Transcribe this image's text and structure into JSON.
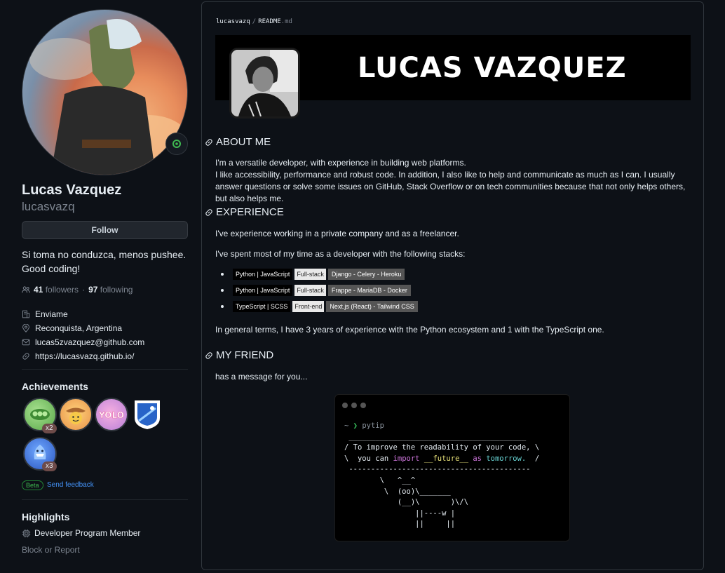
{
  "profile": {
    "name": "Lucas Vazquez",
    "login": "lucasvazq",
    "follow_label": "Follow",
    "bio_line1": "Si toma no conduzca, menos pushee.",
    "bio_line2": "Good coding!",
    "followers_count": "41",
    "followers_label": "followers",
    "separator": "·",
    "following_count": "97",
    "following_label": "following",
    "details": {
      "company": "Enviame",
      "location": "Reconquista, Argentina",
      "email": "lucas5zvazquez@github.com",
      "website": "https://lucasvazq.github.io/"
    }
  },
  "achievements": {
    "title": "Achievements",
    "badges": [
      {
        "name": "pair-extraordinaire",
        "count": "x2",
        "color": "#7bc96f"
      },
      {
        "name": "starstruck-cowboy",
        "count": "",
        "color": "#f4b266"
      },
      {
        "name": "yolo",
        "count": "",
        "color": "#d98ad9"
      },
      {
        "name": "arctic-code-vault",
        "count": "",
        "color": "#3d7fd8"
      },
      {
        "name": "pull-shark",
        "count": "x3",
        "color": "#3a6fd4"
      }
    ],
    "beta_label": "Beta",
    "feedback_label": "Send feedback"
  },
  "highlights": {
    "title": "Highlights",
    "item": "Developer Program Member",
    "block_report": "Block or Report"
  },
  "readme": {
    "breadcrumb_user": "lucasvazq",
    "breadcrumb_sep": "/",
    "breadcrumb_file": "README",
    "breadcrumb_ext": ".md",
    "banner_title": "LUCAS VAZQUEZ",
    "about_heading": "ABOUT ME",
    "about_line1": "I'm a versatile developer, with experience in building web platforms.",
    "about_line2": "I like accessibility, performance and robust code. In addition, I also like to help and communicate as much as I can. I usually answer questions or solve some issues on GitHub, Stack Overflow or on tech communities because that not only helps others, but also helps me.",
    "experience_heading": "EXPERIENCE",
    "exp_p1": "I've experience working in a private company and as a freelancer.",
    "exp_p2": "I've spent most of my time as a developer with the following stacks:",
    "stacks": [
      {
        "lang": "Python | JavaScript",
        "role": "Full-stack",
        "tools": "Django - Celery - Heroku"
      },
      {
        "lang": "Python | JavaScript",
        "role": "Full-stack",
        "tools": "Frappe - MariaDB - Docker"
      },
      {
        "lang": "TypeScript | SCSS",
        "role": "Front-end",
        "tools": "Next.js (React) - Tailwind CSS"
      }
    ],
    "exp_p3": "In general terms, I have 3 years of experience with the Python ecosystem and 1 with the TypeScript one.",
    "friend_heading": "MY FRIEND",
    "friend_p": "has a message for you...",
    "terminal": {
      "prompt_tilde": "~",
      "prompt_arrow": "❯",
      "command": "pytip",
      "top_rule": " ________________________________________",
      "line1": "/ To improve the readability of your code, \\",
      "line2_pre": "\\  you can ",
      "line2_kw": "import",
      "line2_mod": "__future__",
      "line2_as": "as",
      "line2_fn": "tomorrow.",
      "line2_post": "  /",
      "bottom_rule": " -----------------------------------------",
      "cow1": "        \\   ^__^",
      "cow2": "         \\  (oo)\\_______",
      "cow3": "            (__)\\       )\\/\\",
      "cow4": "                ||----w |",
      "cow5": "                ||     ||"
    }
  }
}
